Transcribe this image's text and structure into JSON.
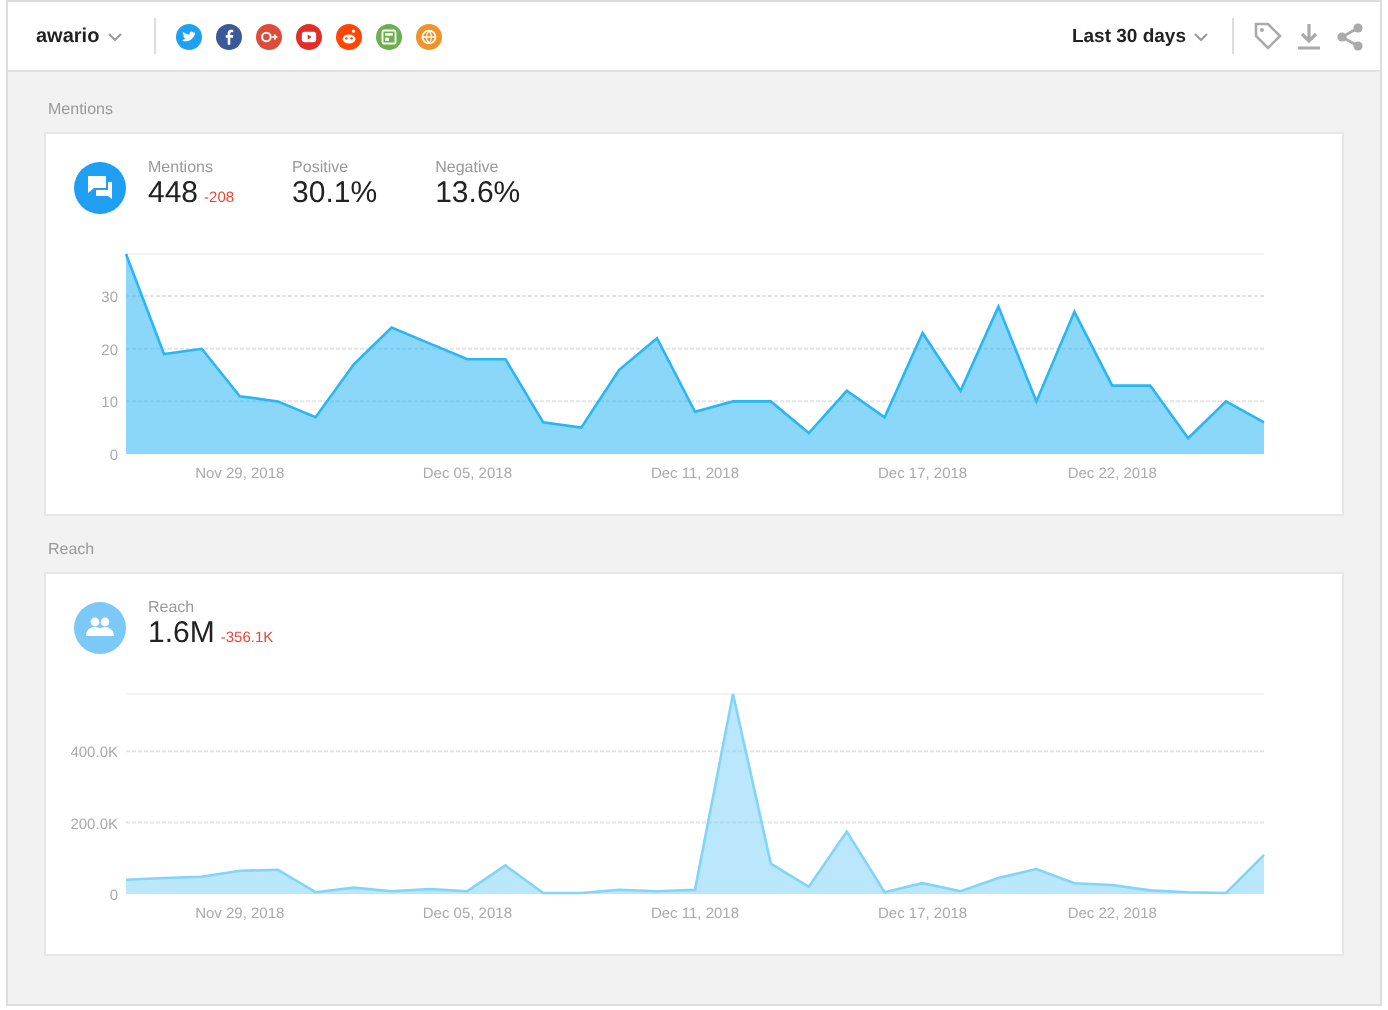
{
  "topbar": {
    "brand": "awario",
    "sources": [
      {
        "kind": "twitter",
        "color": "#1da1f2"
      },
      {
        "kind": "facebook",
        "color": "#3b5998"
      },
      {
        "kind": "googleplus",
        "color": "#dd4b39"
      },
      {
        "kind": "youtube",
        "color": "#e52d27"
      },
      {
        "kind": "reddit",
        "color": "#ff4500"
      },
      {
        "kind": "news",
        "color": "#6ab04c"
      },
      {
        "kind": "web",
        "color": "#f0932b"
      }
    ],
    "period": "Last 30 days"
  },
  "sections": [
    {
      "title": "Mentions",
      "stats": [
        {
          "label": "Mentions",
          "value": "448",
          "change": "-208"
        },
        {
          "label": "Positive",
          "value": "30.1%"
        },
        {
          "label": "Negative",
          "value": "13.6%"
        }
      ],
      "chart_data": {
        "type": "area",
        "categories": [
          null,
          null,
          null,
          "Nov 29, 2018",
          null,
          null,
          null,
          null,
          null,
          "Dec 05, 2018",
          null,
          null,
          null,
          null,
          null,
          "Dec 11, 2018",
          null,
          null,
          null,
          null,
          null,
          "Dec 17, 2018",
          null,
          null,
          null,
          null,
          "Dec 22, 2018",
          null,
          null,
          null,
          null
        ],
        "series": [
          {
            "color": "#29b6f6",
            "values": [
              38,
              19,
              20,
              11,
              10,
              7,
              17,
              24,
              21,
              18,
              18,
              6,
              5,
              16,
              22,
              8,
              10,
              10,
              4,
              12,
              7,
              23,
              12,
              28,
              10,
              27,
              13,
              13,
              3,
              10,
              6
            ]
          }
        ],
        "grid": true,
        "ylim": [
          0,
          38
        ],
        "yticks": [
          0,
          10,
          20,
          30
        ]
      }
    },
    {
      "title": "Reach",
      "stats": [
        {
          "label": "Reach",
          "value": "1.6M",
          "change": "-356.1K"
        }
      ],
      "chart_data": {
        "type": "area",
        "categories": [
          null,
          null,
          null,
          "Nov 29, 2018",
          null,
          null,
          null,
          null,
          null,
          "Dec 05, 2018",
          null,
          null,
          null,
          null,
          null,
          "Dec 11, 2018",
          null,
          null,
          null,
          null,
          null,
          "Dec 17, 2018",
          null,
          null,
          null,
          null,
          "Dec 22, 2018",
          null,
          null,
          null,
          null
        ],
        "series": [
          {
            "color": "#81d4fa",
            "values": [
              40,
              45,
              48,
              65,
              68,
              5,
              18,
              8,
              14,
              8,
              80,
              3,
              3,
              12,
              8,
              12,
              560,
              85,
              20,
              175,
              5,
              30,
              8,
              45,
              70,
              30,
              25,
              10,
              5,
              3,
              110
            ]
          }
        ],
        "grid": true,
        "ylim": [
          0,
          560
        ],
        "yticks": [
          {
            "value": 0,
            "label": "0"
          },
          {
            "value": 200,
            "label": "200.0K"
          },
          {
            "value": 400,
            "label": "400.0K"
          }
        ]
      }
    }
  ]
}
